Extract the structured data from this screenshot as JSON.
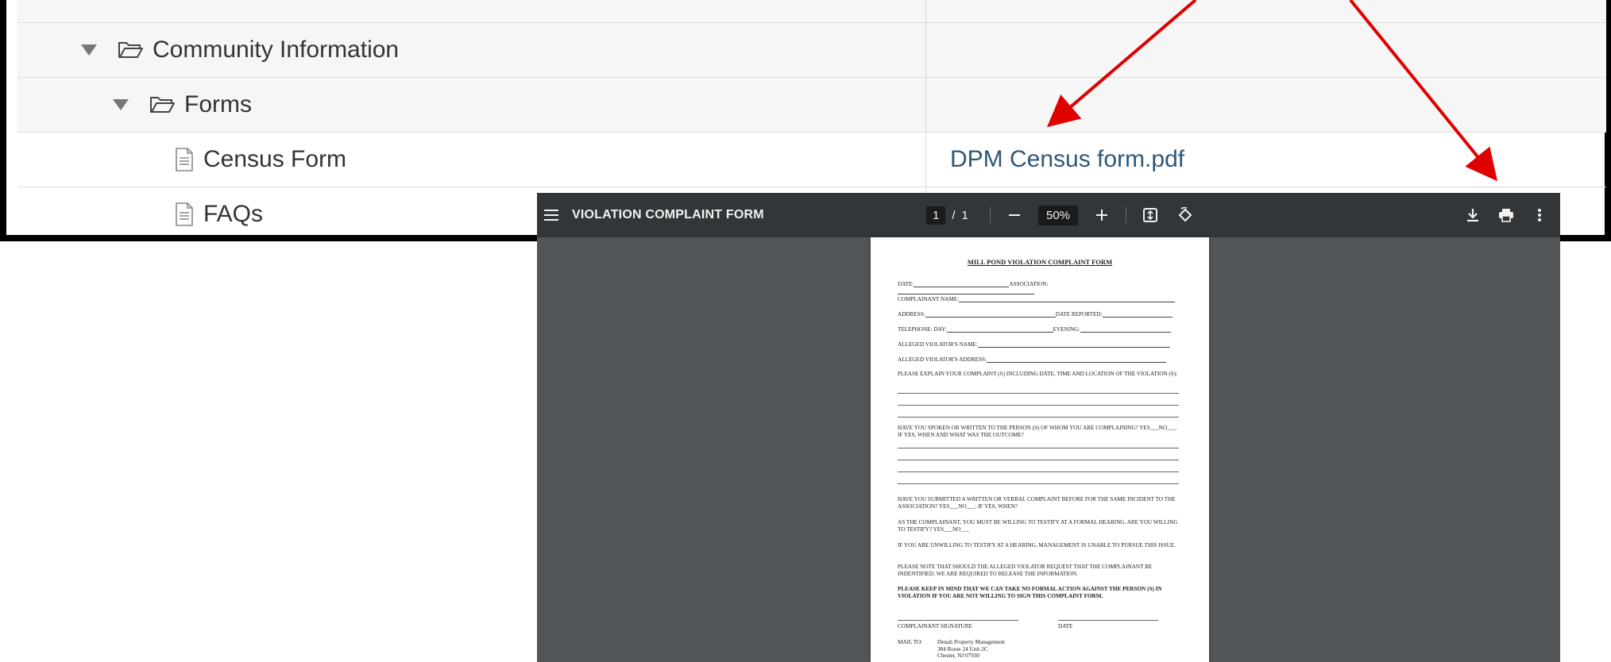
{
  "tree": {
    "rows": [
      {
        "label": "",
        "link": ""
      },
      {
        "label": "Community Information",
        "link": ""
      },
      {
        "label": "Forms",
        "link": ""
      },
      {
        "label": "Census Form",
        "link": "DPM Census form.pdf"
      },
      {
        "label": "FAQs",
        "link": ""
      }
    ]
  },
  "viewer": {
    "title": "VIOLATION COMPLAINT FORM",
    "page_current": "1",
    "page_sep": "/",
    "page_total": "1",
    "zoom": "50%",
    "icons": [
      "menu-icon",
      "zoom-out-icon",
      "zoom-in-icon",
      "fit-page-icon",
      "rotate-icon",
      "download-icon",
      "print-icon",
      "more-vert-icon"
    ]
  },
  "document": {
    "heading": "MILL POND VIOLATION COMPLAINT FORM",
    "fields": {
      "date": "DATE:",
      "association": "ASSOCIATION:",
      "complainant_name": "COMPLAINANT NAME:",
      "address": "ADDRESS:",
      "date_reported": "DATE REPORTED:",
      "telephone_day": "TELEPHONE: DAY:",
      "evening": "EVENING:",
      "violator_name": "ALLEGED VIOLATOR'S NAME:",
      "violator_address": "ALLEGED VIOLATOR'S ADDRESS:"
    },
    "q1": "PLEASE EXPLAIN YOUR COMPLAINT (S) INCLUDING DATE, TIME AND LOCATION OF THE VIOLATION (S):",
    "q2": "HAVE YOU SPOKEN OR WRITTEN TO THE PERSON (S) OF WHOM YOU ARE COMPLAINING? YES___NO___. IF YES, WHEN AND WHAT WAS THE OUTCOME?",
    "q3": "HAVE YOU SUBMITTED A WRITTEN OR VERBAL COMPLAINT BEFORE FOR THE SAME INCIDENT TO THE ASSOCIATION? YES___NO___: IF YES, WHEN?",
    "p1": "AS THE COMPLAINANT, YOU MUST BE WILLING TO TESTIFY AT A FORMAL HEARING. ARE YOU WILLING TO TESTIFY? YES___NO___",
    "p2": "IF YOU ARE UNWILLING TO TESTIFY AT A HEARING, MANAGEMENT IS UNABLE TO PURSUE THIS ISSUE.",
    "p3": "PLEASE NOTE THAT SHOULD THE ALLEGED VIOLATOR REQUEST THAT THE COMPLAINANT BE INDENTIFIED, WE ARE REQUIRED TO RELEASE THE INFORMATION.",
    "p4": "PLEASE KEEP IN MIND THAT WE CAN TAKE NO FORMAL ACTION AGAINST THE PERSON (S) IN VIOLATION IF YOU ARE NOT WILLING TO SIGN THIS COMPLAINT FORM.",
    "signature": "COMPLAINANT SIGNATURE",
    "sig_date": "DATE",
    "mail_to": "MAIL TO:",
    "address_lines": [
      "Denali Property Management",
      "384 Route 24 Unit 2C",
      "Chester, NJ 07930"
    ]
  },
  "colors": {
    "arrow": "#e00000",
    "link": "#2e5878",
    "toolbar": "#323639",
    "viewer_bg": "#525659"
  }
}
